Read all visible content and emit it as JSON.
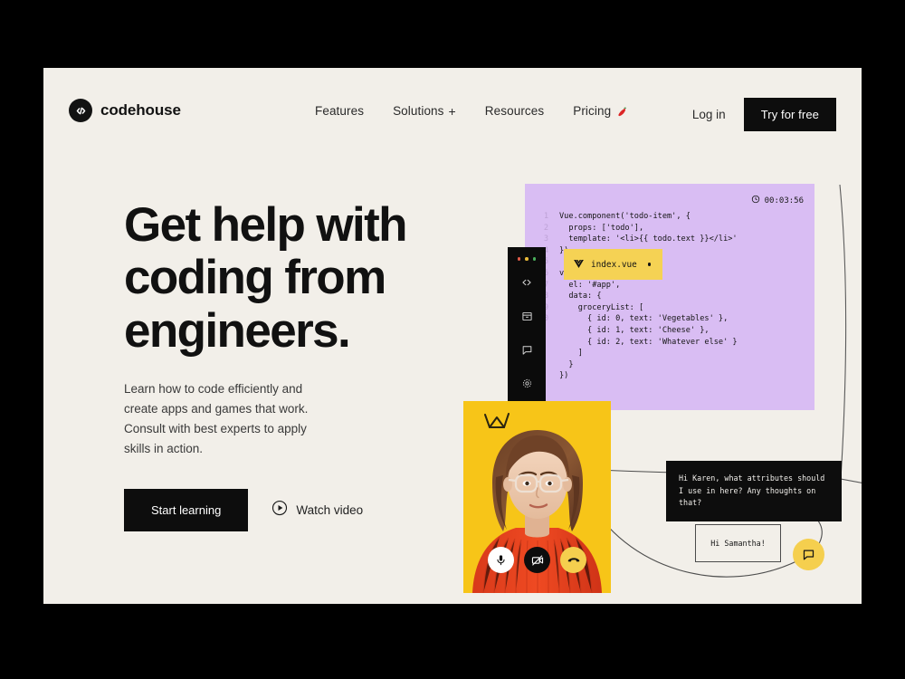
{
  "brand": {
    "name": "codehouse",
    "logo_icon": "code-brackets-icon"
  },
  "nav": {
    "links": [
      {
        "label": "Features",
        "has_plus": false,
        "has_emoji": false
      },
      {
        "label": "Solutions",
        "has_plus": true,
        "has_emoji": false
      },
      {
        "label": "Resources",
        "has_plus": false,
        "has_emoji": false
      },
      {
        "label": "Pricing",
        "has_plus": false,
        "has_emoji": true,
        "emoji": "chili-pepper-icon"
      }
    ],
    "login_label": "Log in",
    "cta_label": "Try for free"
  },
  "hero": {
    "headline": "Get help with coding from engineers.",
    "subtext": "Learn how to code efficiently and create apps and games that work. Consult with best experts to apply skills in action.",
    "primary_button": "Start learning",
    "secondary_button": "Watch video",
    "secondary_icon": "play-circle-icon"
  },
  "ide": {
    "file_tab": {
      "name": "index.vue",
      "icon": "vue-logo-icon",
      "modified_dot": true
    },
    "timer": "00:03:56",
    "timer_icon": "clock-icon",
    "window_dots": [
      "red",
      "yellow",
      "green"
    ],
    "sidebar_icons": [
      "code-brackets-icon",
      "archive-box-icon",
      "chat-bubble-icon",
      "gear-icon"
    ],
    "code": [
      {
        "n": "1",
        "text": "Vue.component('todo-item', {"
      },
      {
        "n": "2",
        "text": "  props: ['todo'],"
      },
      {
        "n": "3",
        "text": "  template: '<li>{{ todo.text }}</li>'"
      },
      {
        "n": "4",
        "text": "})"
      },
      {
        "n": "5",
        "text": ""
      },
      {
        "n": "6",
        "text": "var app = new Vue({"
      },
      {
        "n": "7",
        "text": "  el: '#app',"
      },
      {
        "n": "8",
        "text": "  data: {"
      },
      {
        "n": "9",
        "text": "    groceryList: ["
      },
      {
        "n": "10",
        "text": "      { id: 0, text: 'Vegetables' },"
      },
      {
        "n": "",
        "text": "      { id: 1, text: 'Cheese' },"
      },
      {
        "n": "",
        "text": "      { id: 2, text: 'Whatever else' }"
      },
      {
        "n": "",
        "text": "    ]"
      },
      {
        "n": "",
        "text": "  }"
      },
      {
        "n": "",
        "text": "})"
      }
    ]
  },
  "video_call": {
    "participant_decoration": "crown-doodle-icon",
    "controls": [
      {
        "name": "microphone",
        "icon": "microphone-icon",
        "state": "on"
      },
      {
        "name": "camera",
        "icon": "camera-off-icon",
        "state": "off"
      },
      {
        "name": "hangup",
        "icon": "phone-hangup-icon",
        "state": "active"
      }
    ]
  },
  "chat": {
    "incoming_message": "Hi Karen, what attributes should I use in here? Any thoughts on that?",
    "outgoing_message": "Hi Samantha!",
    "fab_icon": "chat-bubble-icon"
  },
  "colors": {
    "page_background": "#000000",
    "canvas_background": "#f2efe9",
    "accent_black": "#0d0d0d",
    "code_panel": "#d9bdf3",
    "tab_yellow": "#f5d254",
    "photo_yellow": "#f7c518",
    "sweater_red": "#e8401f"
  }
}
